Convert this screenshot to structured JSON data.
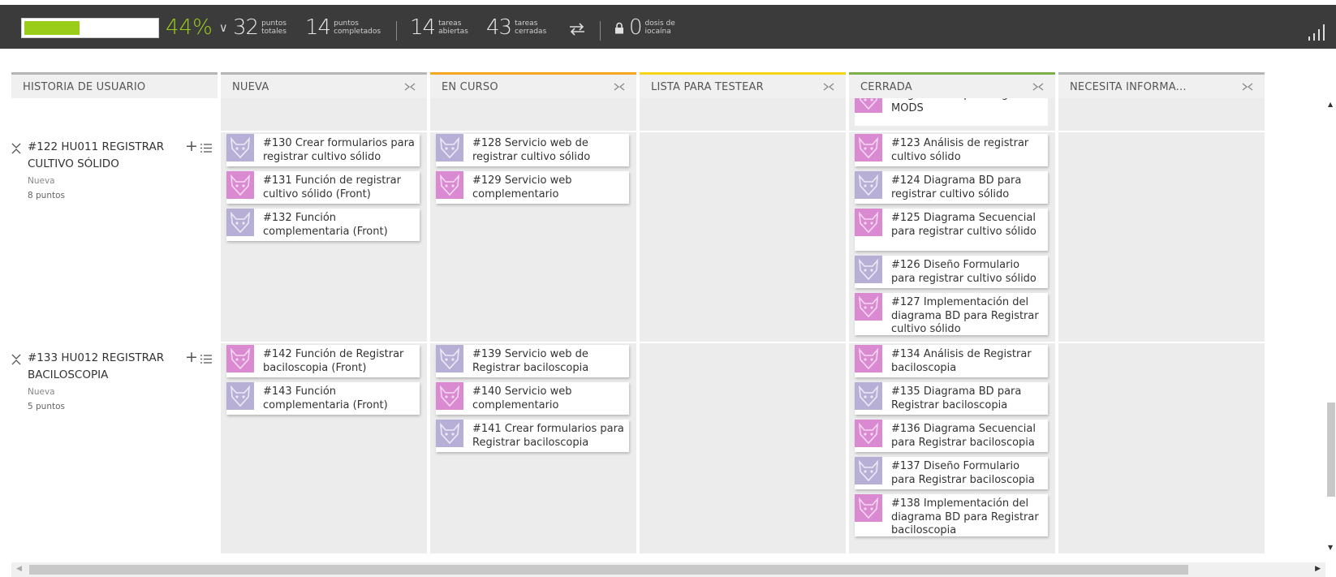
{
  "stats": {
    "progress_fraction": 0.44,
    "percent": "44%",
    "total_points": "32",
    "total_points_label_1": "puntos",
    "total_points_label_2": "totales",
    "done_points": "14",
    "done_points_label_1": "puntos",
    "done_points_label_2": "completados",
    "open_tasks": "14",
    "open_tasks_label_1": "tareas",
    "open_tasks_label_2": "abiertas",
    "closed_tasks": "43",
    "closed_tasks_label_1": "tareas",
    "closed_tasks_label_2": "cerradas",
    "iocaine": "0",
    "iocaine_label_1": "dosis de",
    "iocaine_label_2": "iocaína"
  },
  "columns": {
    "story": "HISTORIA DE USUARIO",
    "new": "NUEVA",
    "in_progress": "EN CURSO",
    "ready_test": "LISTA PARA TESTEAR",
    "closed": "CERRADA",
    "needs_info": "NECESITA INFORMA..."
  },
  "colors": {
    "new": "#b5b5b5",
    "in_progress": "#f5a623",
    "ready_test": "#f7d417",
    "closed": "#7ab04a",
    "needs_info": "#b5b5b5",
    "progress": "#9acd1a"
  },
  "top_partial_card": "diagrama BD para registrar MODS",
  "stories": [
    {
      "title": "#122 HU011 REGISTRAR CULTIVO SÓLIDO",
      "status": "Nueva",
      "points": "8 puntos",
      "new": [
        "#130 Crear formularios para registrar cultivo sólido",
        "#131 Función de registrar cultivo sólido (Front)",
        "#132 Función complementaria (Front)"
      ],
      "in_progress": [
        "#128 Servicio web de registrar cultivo sólido",
        "#129 Servicio web complementario"
      ],
      "closed": [
        "#123 Análisis de registrar cultivo sólido",
        "#124 Diagrama BD para registrar cultivo sólido",
        "#125 Diagrama Secuencial para registrar cultivo sólido",
        "#126 Diseño Formulario para registrar cultivo sólido",
        "#127 Implementación del diagrama BD para Registrar cultivo sólido"
      ]
    },
    {
      "title": "#133 HU012 REGISTRAR BACILOSCOPIA",
      "status": "Nueva",
      "points": "5 puntos",
      "new": [
        "#142 Función de Registrar baciloscopia (Front)",
        "#143 Función complementaria (Front)"
      ],
      "in_progress": [
        "#139 Servicio web de Registrar baciloscopia",
        "#140 Servicio web complementario",
        "#141 Crear formularios para Registrar baciloscopia"
      ],
      "closed": [
        "#134 Análisis de Registrar baciloscopia",
        "#135 Diagrama BD para Registrar baciloscopia",
        "#136 Diagrama Secuencial para Registrar baciloscopia",
        "#137 Diseño Formulario para Registrar baciloscopia",
        "#138 Implementación del diagrama BD para Registrar baciloscopia"
      ]
    }
  ]
}
